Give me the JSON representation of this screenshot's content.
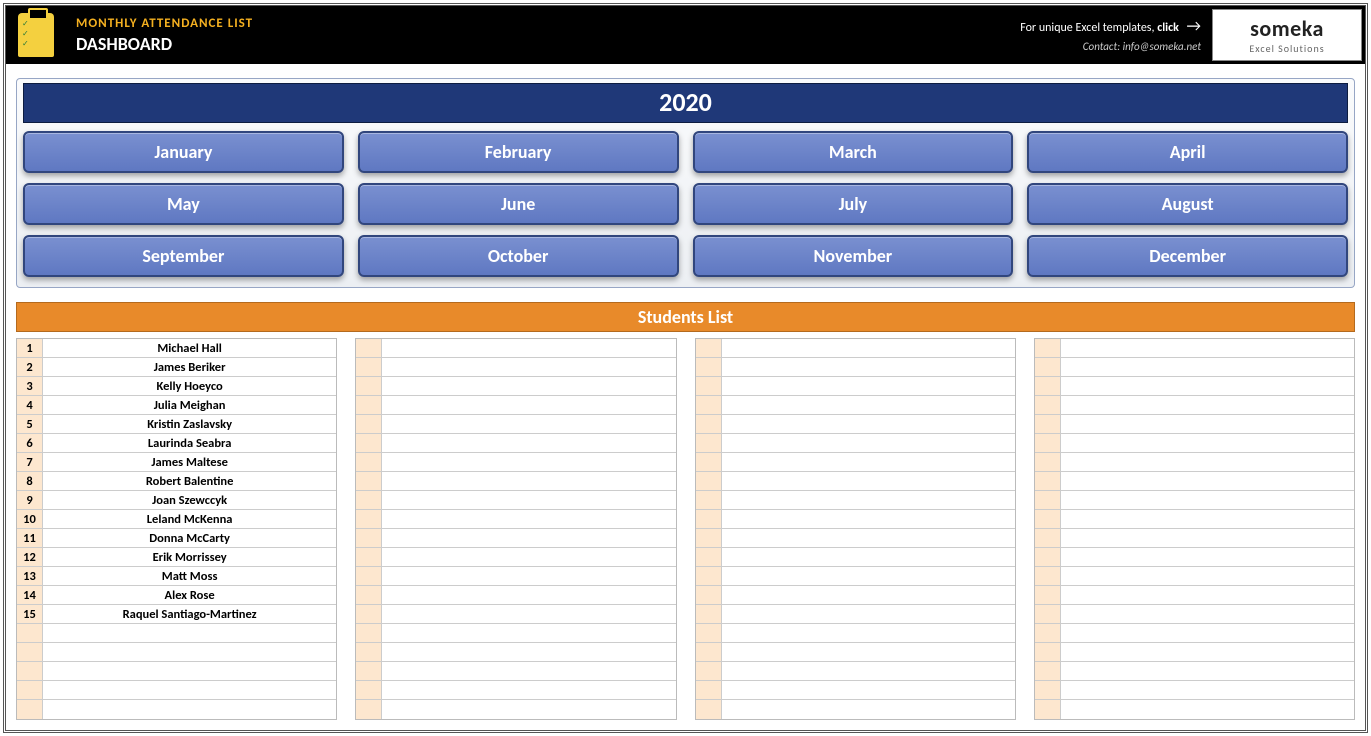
{
  "header": {
    "title_line1": "MONTHLY ATTENDANCE LIST",
    "title_line2": "DASHBOARD",
    "promo_prefix": "For unique Excel templates, ",
    "promo_bold": "click",
    "contact_prefix": "Contact: ",
    "contact_email": "info@someka.net",
    "brand_main": "someka",
    "brand_sub": "Excel Solutions"
  },
  "year": "2020",
  "months": [
    "January",
    "February",
    "March",
    "April",
    "May",
    "June",
    "July",
    "August",
    "September",
    "October",
    "November",
    "December"
  ],
  "students_header": "Students List",
  "columns": [
    [
      {
        "n": "1",
        "name": "Michael Hall"
      },
      {
        "n": "2",
        "name": "James Beriker"
      },
      {
        "n": "3",
        "name": "Kelly Hoeyco"
      },
      {
        "n": "4",
        "name": "Julia Meighan"
      },
      {
        "n": "5",
        "name": "Kristin Zaslavsky"
      },
      {
        "n": "6",
        "name": "Laurinda Seabra"
      },
      {
        "n": "7",
        "name": "James Maltese"
      },
      {
        "n": "8",
        "name": "Robert Balentine"
      },
      {
        "n": "9",
        "name": "Joan Szewccyk"
      },
      {
        "n": "10",
        "name": "Leland McKenna"
      },
      {
        "n": "11",
        "name": "Donna McCarty"
      },
      {
        "n": "12",
        "name": "Erik Morrissey"
      },
      {
        "n": "13",
        "name": "Matt Moss"
      },
      {
        "n": "14",
        "name": "Alex Rose"
      },
      {
        "n": "15",
        "name": "Raquel Santiago-Martinez"
      },
      {
        "n": "",
        "name": ""
      },
      {
        "n": "",
        "name": ""
      },
      {
        "n": "",
        "name": ""
      },
      {
        "n": "",
        "name": ""
      },
      {
        "n": "",
        "name": ""
      }
    ],
    [
      {
        "n": "",
        "name": ""
      },
      {
        "n": "",
        "name": ""
      },
      {
        "n": "",
        "name": ""
      },
      {
        "n": "",
        "name": ""
      },
      {
        "n": "",
        "name": ""
      },
      {
        "n": "",
        "name": ""
      },
      {
        "n": "",
        "name": ""
      },
      {
        "n": "",
        "name": ""
      },
      {
        "n": "",
        "name": ""
      },
      {
        "n": "",
        "name": ""
      },
      {
        "n": "",
        "name": ""
      },
      {
        "n": "",
        "name": ""
      },
      {
        "n": "",
        "name": ""
      },
      {
        "n": "",
        "name": ""
      },
      {
        "n": "",
        "name": ""
      },
      {
        "n": "",
        "name": ""
      },
      {
        "n": "",
        "name": ""
      },
      {
        "n": "",
        "name": ""
      },
      {
        "n": "",
        "name": ""
      },
      {
        "n": "",
        "name": ""
      }
    ],
    [
      {
        "n": "",
        "name": ""
      },
      {
        "n": "",
        "name": ""
      },
      {
        "n": "",
        "name": ""
      },
      {
        "n": "",
        "name": ""
      },
      {
        "n": "",
        "name": ""
      },
      {
        "n": "",
        "name": ""
      },
      {
        "n": "",
        "name": ""
      },
      {
        "n": "",
        "name": ""
      },
      {
        "n": "",
        "name": ""
      },
      {
        "n": "",
        "name": ""
      },
      {
        "n": "",
        "name": ""
      },
      {
        "n": "",
        "name": ""
      },
      {
        "n": "",
        "name": ""
      },
      {
        "n": "",
        "name": ""
      },
      {
        "n": "",
        "name": ""
      },
      {
        "n": "",
        "name": ""
      },
      {
        "n": "",
        "name": ""
      },
      {
        "n": "",
        "name": ""
      },
      {
        "n": "",
        "name": ""
      },
      {
        "n": "",
        "name": ""
      }
    ],
    [
      {
        "n": "",
        "name": ""
      },
      {
        "n": "",
        "name": ""
      },
      {
        "n": "",
        "name": ""
      },
      {
        "n": "",
        "name": ""
      },
      {
        "n": "",
        "name": ""
      },
      {
        "n": "",
        "name": ""
      },
      {
        "n": "",
        "name": ""
      },
      {
        "n": "",
        "name": ""
      },
      {
        "n": "",
        "name": ""
      },
      {
        "n": "",
        "name": ""
      },
      {
        "n": "",
        "name": ""
      },
      {
        "n": "",
        "name": ""
      },
      {
        "n": "",
        "name": ""
      },
      {
        "n": "",
        "name": ""
      },
      {
        "n": "",
        "name": ""
      },
      {
        "n": "",
        "name": ""
      },
      {
        "n": "",
        "name": ""
      },
      {
        "n": "",
        "name": ""
      },
      {
        "n": "",
        "name": ""
      },
      {
        "n": "",
        "name": ""
      }
    ]
  ]
}
